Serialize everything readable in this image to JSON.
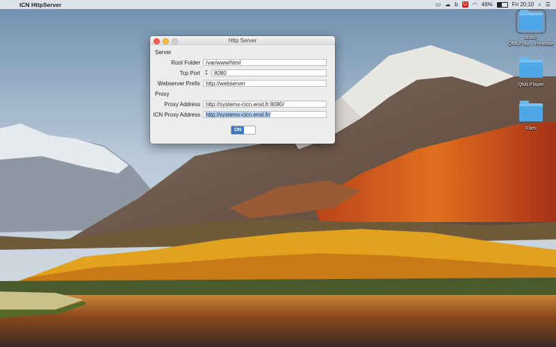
{
  "menubar": {
    "apple_icon": "apple-icon",
    "app_name": "ICN HttpServer",
    "battery": "46%",
    "time": "Fri 20:10",
    "status_icons": [
      "screen-mirroring-icon",
      "cloud-icon",
      "b-icon",
      "shield-icon",
      "wifi-icon"
    ]
  },
  "desktop": {
    "items": [
      {
        "label": "build-\nQMLPlay...-Release"
      },
      {
        "label": "QMLPlayer"
      },
      {
        "label": "Files"
      }
    ]
  },
  "window": {
    "title": "Http Server",
    "server_section": "Server",
    "proxy_section": "Proxy",
    "fields": {
      "root_folder": {
        "label": "Root Folder",
        "value": "/var/www/html"
      },
      "tcp_port": {
        "label": "Tcp Port",
        "value": "8080"
      },
      "webserver_prefix": {
        "label": "Webserver Prefix",
        "value": "http://webserver"
      },
      "proxy_address": {
        "label": "Proxy Address",
        "value": "http://systemx-cicn.enst.fr:8080/"
      },
      "icn_proxy_address": {
        "label": "ICN Proxy Address",
        "value": "http://systemx-cicn.enst.fr/"
      }
    },
    "toggle": {
      "label": "ON",
      "state": true
    }
  },
  "colors": {
    "accent": "#3a77c9",
    "selection": "#b3d4fc",
    "close": "#fc605b",
    "minimize": "#fdbc40"
  }
}
